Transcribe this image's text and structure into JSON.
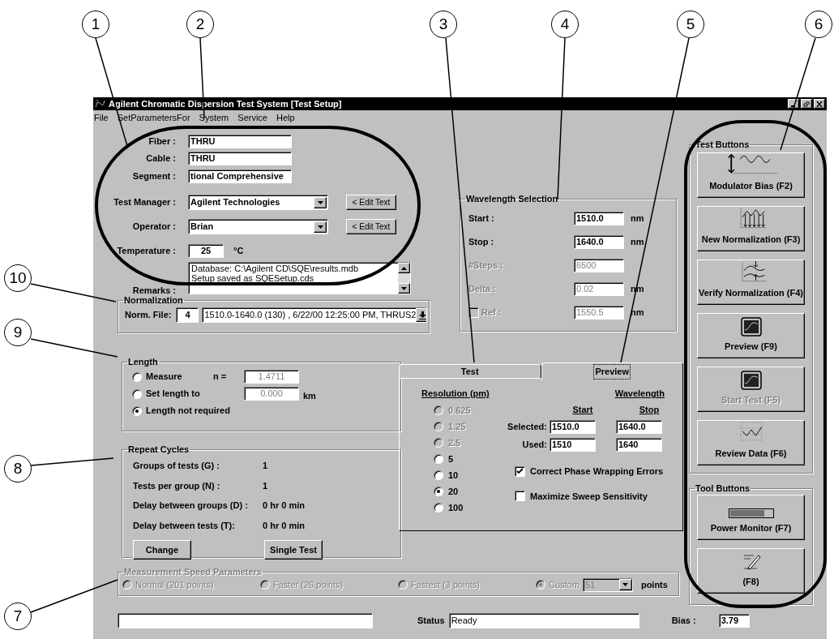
{
  "callouts": [
    {
      "label": "1"
    },
    {
      "label": "2"
    },
    {
      "label": "3"
    },
    {
      "label": "4"
    },
    {
      "label": "5"
    },
    {
      "label": "6"
    },
    {
      "label": "10"
    },
    {
      "label": "9"
    },
    {
      "label": "8"
    },
    {
      "label": "7"
    }
  ],
  "window": {
    "title": "Agilent Chromatic Dispersion Test System [Test Setup]"
  },
  "menu": [
    "File",
    "SetParametersFor",
    "System",
    "Service",
    "Help"
  ],
  "setup_fields": [
    {
      "kind": "text",
      "label": "Fiber :",
      "value": "THRU"
    },
    {
      "kind": "text",
      "label": "Cable :",
      "value": "THRU"
    },
    {
      "kind": "text",
      "label": "Segment :",
      "value": "tional Comprehensive"
    },
    {
      "kind": "combo",
      "label": "Test Manager :",
      "value": "Agilent Technologies",
      "button": "< Edit Text"
    },
    {
      "kind": "combo",
      "label": "Operator :",
      "value": "Brian",
      "button": "< Edit Text"
    },
    {
      "kind": "temperature",
      "label": "Temperature :",
      "value": "25",
      "unit": "°C"
    }
  ],
  "remarks": {
    "label": "Remarks :",
    "lines": [
      "Database: C:\\Agilent CD\\SQE\\results.mdb",
      "Setup saved as SQESetup.cds"
    ]
  },
  "normalization": {
    "title": "Normalization",
    "label": "Norm. File:",
    "number": "4",
    "file": "1510.0-1640.0 (130) , 6/22/00 12:25:00 PM, THRUS2"
  },
  "wavelength_selection": {
    "title": "Wavelength Selection",
    "rows": [
      {
        "kind": "field",
        "label": "Start :",
        "value": "1510.0",
        "unit": "nm",
        "disabled": false
      },
      {
        "kind": "field",
        "label": "Stop :",
        "value": "1640.0",
        "unit": "nm",
        "disabled": false
      },
      {
        "kind": "field",
        "label": "#Steps :",
        "value": "6500",
        "disabled": true
      },
      {
        "kind": "field",
        "label": "Delta :",
        "value": "0.02",
        "unit": "nm",
        "disabled": true
      },
      {
        "kind": "checkbox",
        "label": "Ref :",
        "value": "1550.5",
        "unit": "nm",
        "disabled": true,
        "checked": false
      }
    ]
  },
  "length": {
    "title": "Length",
    "options": [
      {
        "label": "Measure",
        "selected": false,
        "field_label": "n =",
        "value": "1.4711"
      },
      {
        "label": "Set length to",
        "selected": false,
        "value": "0.000",
        "unit": "km"
      },
      {
        "label": "Length not required",
        "selected": true
      }
    ]
  },
  "repeat_cycles": {
    "title": "Repeat Cycles",
    "rows": [
      {
        "label": "Groups of tests (G) :",
        "value": "1"
      },
      {
        "label": "Tests per group (N) :",
        "value": "1"
      },
      {
        "label": "Delay between groups (D) :",
        "value": "0 hr 0 min"
      },
      {
        "label": "Delay between tests (T):",
        "value": "0 hr 0 min"
      }
    ],
    "buttons": [
      "Change",
      "Single Test"
    ]
  },
  "tabs": [
    {
      "label": "Test",
      "selected": false
    },
    {
      "label": "Preview",
      "selected": true
    }
  ],
  "preview": {
    "resolution_title": "Resolution (pm)",
    "resolutions": [
      {
        "label": "0.625",
        "selected": false,
        "disabled": true
      },
      {
        "label": "1.25",
        "selected": false,
        "disabled": true
      },
      {
        "label": "2.5",
        "selected": false,
        "disabled": true
      },
      {
        "label": "5",
        "selected": false,
        "disabled": false
      },
      {
        "label": "10",
        "selected": false,
        "disabled": false
      },
      {
        "label": "20",
        "selected": true,
        "disabled": false
      },
      {
        "label": "100",
        "selected": false,
        "disabled": false
      }
    ],
    "wavelength_title": "Wavelength",
    "columns": [
      "Start",
      "Stop"
    ],
    "rows": [
      {
        "label": "Selected:",
        "start": "1510.0",
        "stop": "1640.0"
      },
      {
        "label": "Used:",
        "start": "1510",
        "stop": "1640"
      }
    ],
    "options": [
      {
        "label": "Correct Phase Wrapping Errors",
        "checked": true
      },
      {
        "label": "Maximize Sweep Sensitivity",
        "checked": false
      }
    ]
  },
  "test_buttons": {
    "title": "Test Buttons",
    "buttons": [
      {
        "label": "Modulator Bias (F2)",
        "kind": "bias",
        "disabled": false
      },
      {
        "label": "New Normalization (F3)",
        "kind": "normalize",
        "disabled": false
      },
      {
        "label": "Verify Normalization (F4)",
        "kind": "verify",
        "disabled": false
      },
      {
        "label": "Preview (F9)",
        "kind": "scope",
        "disabled": false
      },
      {
        "label": "Start Test (F5)",
        "kind": "scope",
        "disabled": true
      },
      {
        "label": "Review Data (F6)",
        "kind": "review",
        "disabled": false
      }
    ]
  },
  "tool_buttons": {
    "title": "Tool Buttons",
    "buttons": [
      {
        "label": "Power Monitor (F7)",
        "kind": "meter",
        "disabled": false
      },
      {
        "label": "(F8)",
        "kind": "notepad",
        "disabled": false
      }
    ]
  },
  "speed": {
    "title": "Measurement Speed Parameters",
    "disabled": true,
    "options": [
      {
        "label": "Normal (201 points)",
        "selected": false
      },
      {
        "label": "Faster (26 points)",
        "selected": false
      },
      {
        "label": "Fastest (3 points)",
        "selected": false
      },
      {
        "label": "Custom",
        "selected": true,
        "value": "51",
        "unit": "points"
      }
    ]
  },
  "status_bar": {
    "status_label": "Status",
    "status": "Ready",
    "bias_label": "Bias :",
    "bias": "3.79"
  }
}
